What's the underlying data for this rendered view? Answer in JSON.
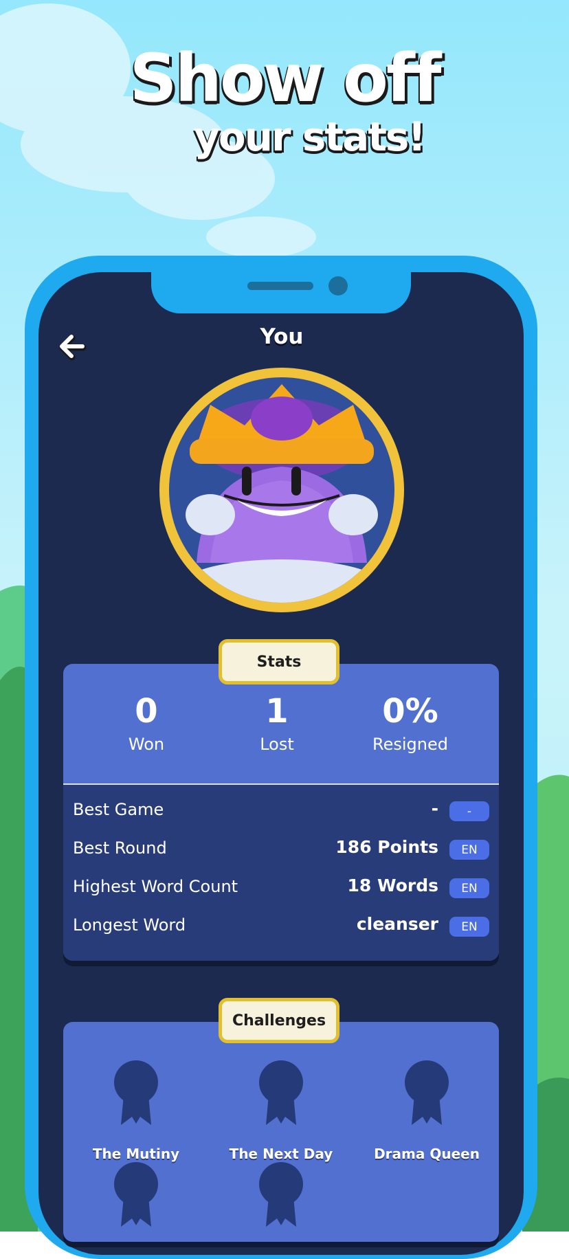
{
  "headline": {
    "line1": "Show off",
    "line2": "your stats!"
  },
  "screen": {
    "title": "You",
    "back_icon": "arrow-left-icon"
  },
  "stats": {
    "header": "Stats",
    "summary": [
      {
        "value": "0",
        "label": "Won"
      },
      {
        "value": "1",
        "label": "Lost"
      },
      {
        "value": "0%",
        "label": "Resigned"
      }
    ],
    "records": [
      {
        "label": "Best Game",
        "value": "-",
        "badge": "-"
      },
      {
        "label": "Best Round",
        "value": "186 Points",
        "badge": "EN"
      },
      {
        "label": "Highest Word Count",
        "value": "18 Words",
        "badge": "EN"
      },
      {
        "label": "Longest Word",
        "value": "cleanser",
        "badge": "EN"
      }
    ]
  },
  "challenges": {
    "header": "Challenges",
    "items": [
      {
        "label": "The Mutiny",
        "icon": "ribbon-badge-icon"
      },
      {
        "label": "The Next Day",
        "icon": "ribbon-badge-icon"
      },
      {
        "label": "Drama Queen",
        "icon": "ribbon-badge-icon"
      },
      {
        "label": "",
        "icon": "ribbon-badge-icon"
      },
      {
        "label": "",
        "icon": "ribbon-badge-icon"
      }
    ]
  },
  "colors": {
    "sky": "#8fe6fb",
    "phone_frame": "#1fa9ef",
    "screen_bg": "#1c2a4f",
    "card_blue": "#5270cf",
    "card_dark": "#283c7a",
    "badge_blue": "#4b6ee6",
    "gold": "#e2bf2d"
  }
}
